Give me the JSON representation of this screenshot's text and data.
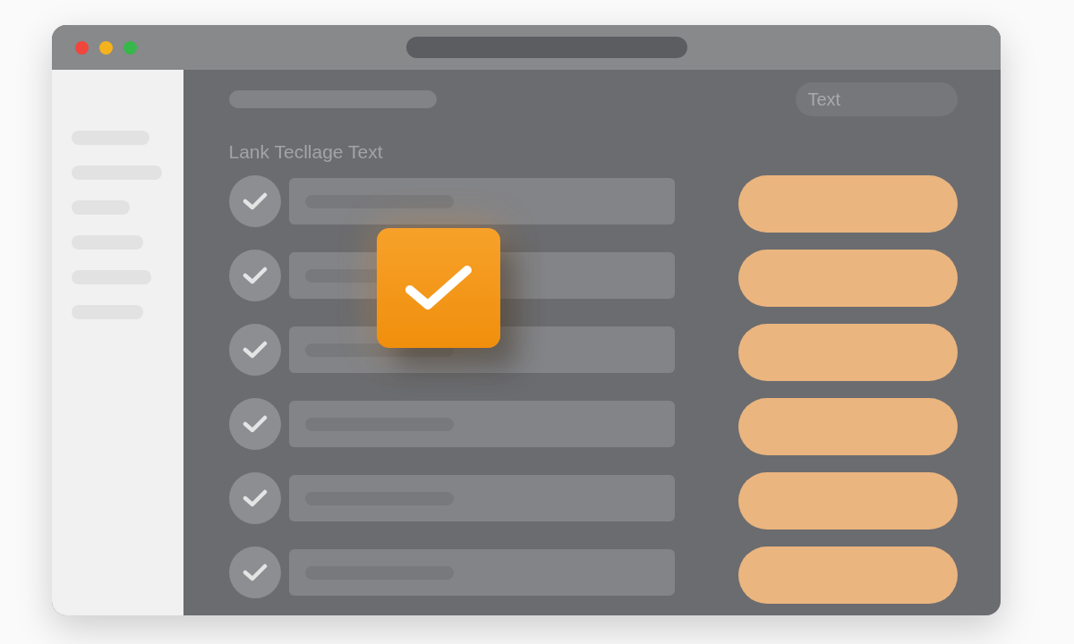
{
  "search": {
    "placeholder": "Text"
  },
  "heading": "Lank Tecllage Text",
  "rows": [
    {
      "checked": true
    },
    {
      "checked": true
    },
    {
      "checked": true
    },
    {
      "checked": true
    },
    {
      "checked": true
    },
    {
      "checked": true
    }
  ]
}
